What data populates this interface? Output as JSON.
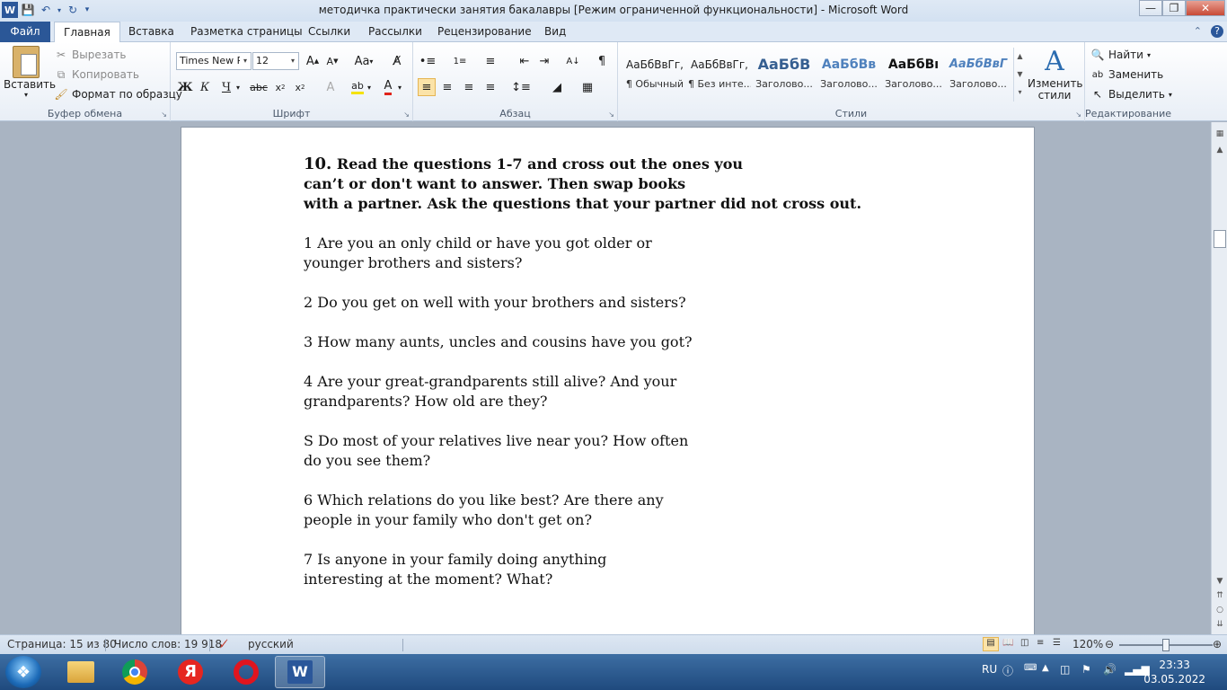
{
  "window": {
    "title": "методичка практически занятия бакалавры [Режим ограниченной функциональности]  -  Microsoft Word"
  },
  "tabs": {
    "file": "Файл",
    "items": [
      "Главная",
      "Вставка",
      "Разметка страницы",
      "Ссылки",
      "Рассылки",
      "Рецензирование",
      "Вид"
    ]
  },
  "ribbon": {
    "clipboard": {
      "label": "Буфер обмена",
      "paste": "Вставить",
      "cut": "Вырезать",
      "copy": "Копировать",
      "format_painter": "Формат по образцу"
    },
    "font": {
      "label": "Шрифт",
      "name": "Times New Ro",
      "size": "12"
    },
    "paragraph": {
      "label": "Абзац"
    },
    "styles": {
      "label": "Стили",
      "items": [
        {
          "sample": "АаБбВвГг,",
          "name": "¶ Обычный"
        },
        {
          "sample": "АаБбВвГг,",
          "name": "¶ Без инте..."
        },
        {
          "sample": "АаБбВ",
          "name": "Заголово..."
        },
        {
          "sample": "АаБбВв",
          "name": "Заголово..."
        },
        {
          "sample": "АаБбВı",
          "name": "Заголово..."
        },
        {
          "sample": "АаБбВвГ",
          "name": "Заголово..."
        }
      ],
      "change_styles": "Изменить стили"
    },
    "editing": {
      "label": "Редактирование",
      "find": "Найти",
      "replace": "Заменить",
      "select": "Выделить"
    }
  },
  "document": {
    "heading_number": "10.",
    "heading_lines": [
      " Read the questions 1-7 and cross out the ones you",
      "can’t or don't want to answer. Then swap books",
      "with a partner. Ask the questions that your partner did not cross out."
    ],
    "questions": [
      [
        "1 Are you an only child or have you got older or",
        "younger brothers and sisters?"
      ],
      [
        "2 Do you get on well with your brothers and sisters?"
      ],
      [
        "3 How many aunts, uncles and cousins have you got?"
      ],
      [
        "4 Are your great-grandparents still alive? And your",
        "grandparents? How old are they?"
      ],
      [
        "S Do most of your relatives live near you? How often",
        "do you see them?"
      ],
      [
        "6 Which relations do you like best? Are there any",
        "people in your family who don't get on?"
      ],
      [
        "7 Is anyone in your family doing anything",
        "interesting at the moment? What?"
      ]
    ]
  },
  "statusbar": {
    "page": "Страница: 15 из 80",
    "words": "Число слов: 19 918",
    "language": "русский",
    "zoom": "120%"
  },
  "taskbar": {
    "lang": "RU",
    "time": "23:33",
    "date": "03.05.2022"
  },
  "colors": {
    "file_tab": "#2b5797",
    "taskbar": "#1f4a7e"
  }
}
